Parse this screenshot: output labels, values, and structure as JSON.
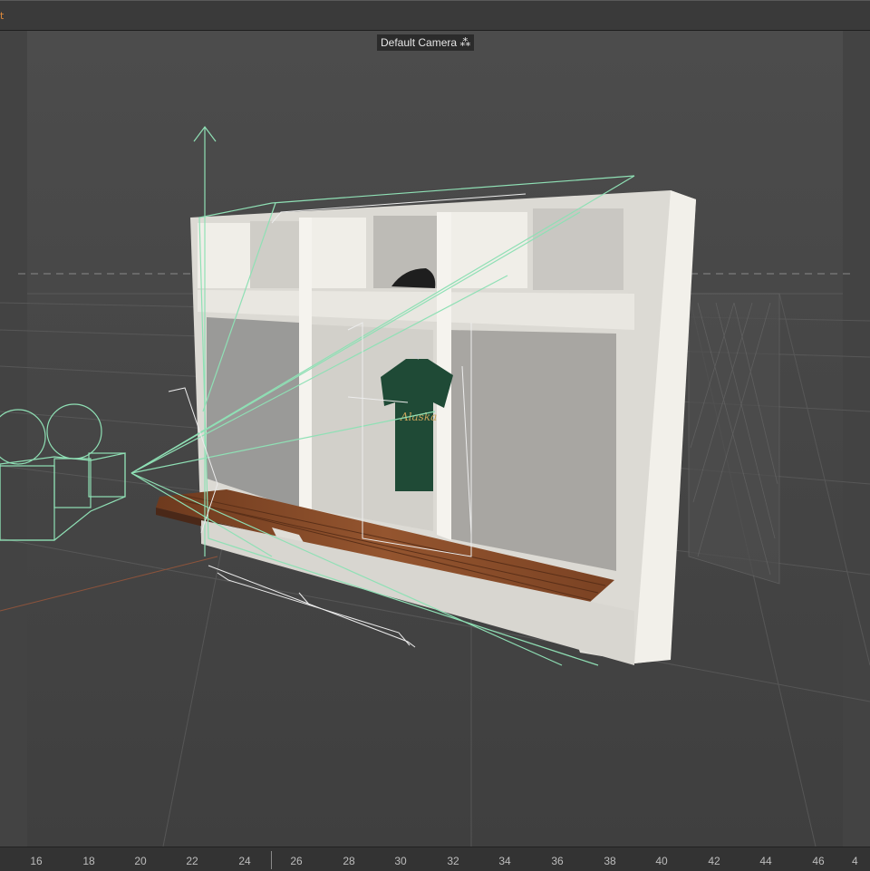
{
  "menubar": {
    "fragment": "t"
  },
  "viewport": {
    "camera_label": "Default Camera",
    "camera_icon": "camera-icon"
  },
  "scene": {
    "object": "locker-with-bench",
    "jersey_text": "Alaska"
  },
  "timeline": {
    "ticks": [
      "16",
      "18",
      "20",
      "22",
      "24",
      "26",
      "28",
      "30",
      "32",
      "34",
      "36",
      "38",
      "40",
      "42",
      "44",
      "46",
      "4"
    ]
  },
  "colors": {
    "wire_green": "#7fd3a6",
    "grid": "#5a5a5a",
    "bench_wood": "#8a4b2a",
    "locker_white": "#e8e6e0"
  }
}
